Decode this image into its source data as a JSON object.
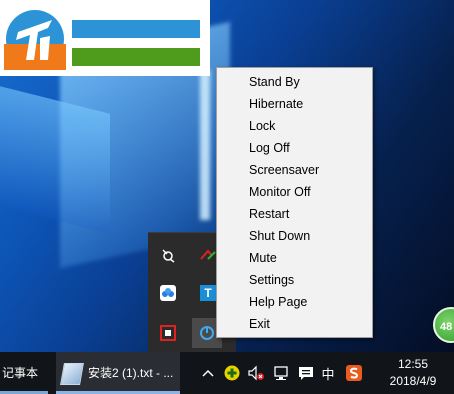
{
  "context_menu": {
    "items": [
      "Stand By",
      "Hibernate",
      "Lock",
      "Log Off",
      "Screensaver",
      "Monitor Off",
      "Restart",
      "Shut Down",
      "Mute",
      "Settings",
      "Help Page",
      "Exit"
    ]
  },
  "taskbar": {
    "notepad_label": "记事本",
    "window_label": "安装2 (1).txt - ...",
    "ime_label": "中",
    "time": "12:55",
    "date": "2018/4/9"
  },
  "tray_flyout": {
    "t_label": "T"
  },
  "desktop": {
    "badge_text": "48"
  },
  "colors": {
    "menu_bg": "#f2f2f2",
    "taskbar_bg": "#111418",
    "logo_blue": "#2b93d6",
    "logo_green": "#4f9b1c",
    "logo_orange": "#f07a1a"
  },
  "icons": {
    "flyout": [
      "satellite-icon",
      "red-green-arrow-icon",
      "cloud-app-icon",
      "t-app-icon",
      "red-frame-app-icon",
      "power-app-icon"
    ],
    "system_tray": [
      "chevron-up-icon",
      "add-plus-icon",
      "speaker-muted-icon",
      "network-icon",
      "action-center-icon",
      "ime-icon",
      "sogou-icon"
    ]
  }
}
